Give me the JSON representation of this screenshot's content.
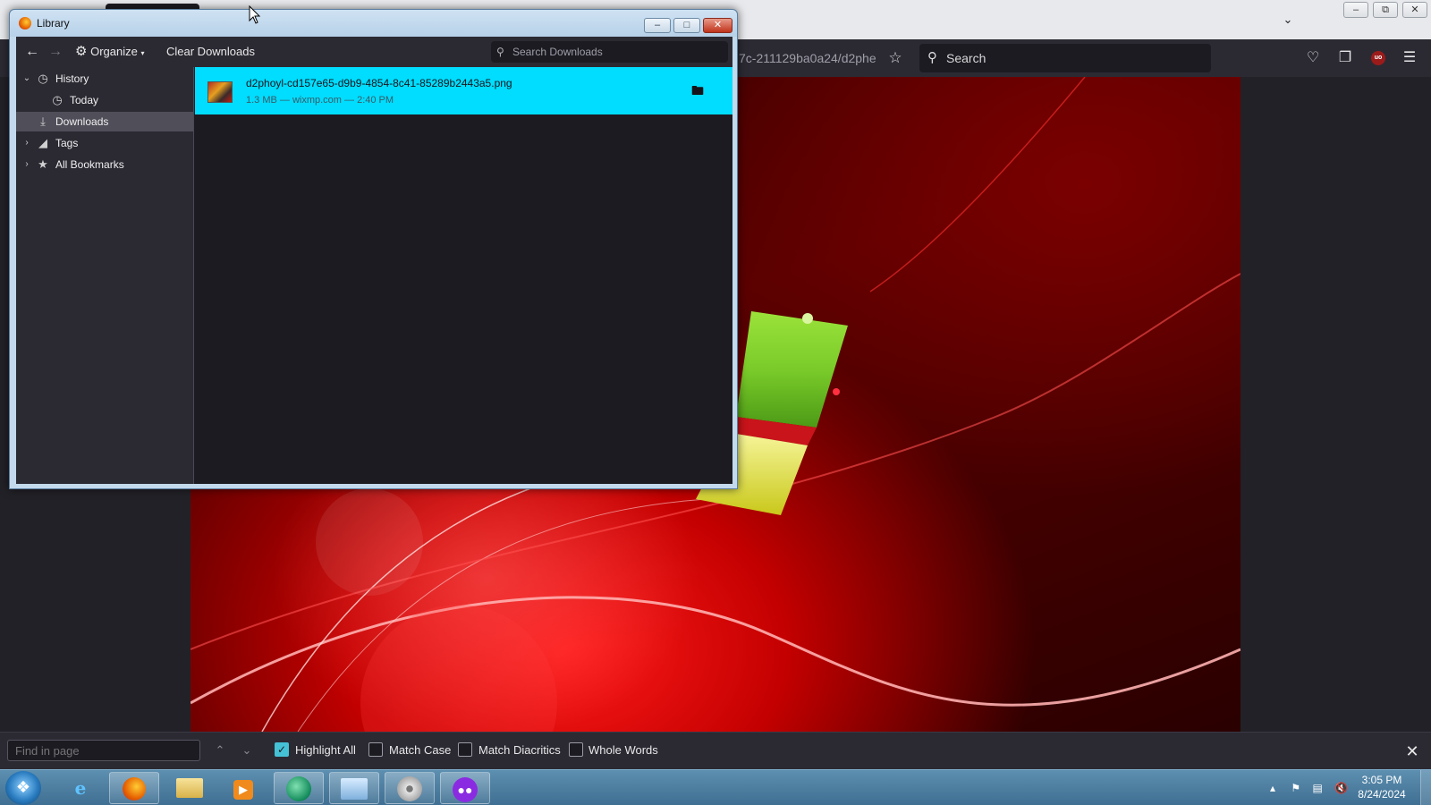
{
  "browser": {
    "url_fragment": "7c-211129ba0a24/d2phe",
    "search_placeholder": "Search",
    "list_all_tabs_icon": "chevron-down-icon",
    "window_buttons": [
      "minimize",
      "restore",
      "close"
    ],
    "ublock_label": "uo"
  },
  "library": {
    "title": "Library",
    "toolbar": {
      "organize_label": "Organize",
      "clear_downloads_label": "Clear Downloads",
      "search_placeholder": "Search Downloads"
    },
    "tree": [
      {
        "label": "History",
        "expanded": true
      },
      {
        "label": "Today"
      },
      {
        "label": "Downloads",
        "selected": true
      },
      {
        "label": "Tags",
        "expanded": false
      },
      {
        "label": "All Bookmarks",
        "expanded": false
      }
    ],
    "downloads": [
      {
        "filename": "d2phoyl-cd157e65-d9b9-4854-8c41-85289b2443a5.png",
        "meta": "1.3 MB — wixmp.com — 2:40 PM"
      }
    ]
  },
  "findbar": {
    "placeholder": "Find in page",
    "options": [
      {
        "label": "Highlight All",
        "checked": true
      },
      {
        "label": "Match Case",
        "checked": false
      },
      {
        "label": "Match Diacritics",
        "checked": false
      },
      {
        "label": "Whole Words",
        "checked": false
      }
    ]
  },
  "taskbar": {
    "apps": [
      "internet-explorer",
      "firefox",
      "file-explorer",
      "media-player",
      "app-green",
      "control-panel",
      "disc-app",
      "app-mask"
    ],
    "clock_time": "3:05 PM",
    "clock_date": "8/24/2024"
  },
  "colors": {
    "accent": "#00ddff",
    "browser_chrome": "#2b2a33",
    "library_frame": "#c3d9ec",
    "checkbox_on": "#45c1d6"
  }
}
